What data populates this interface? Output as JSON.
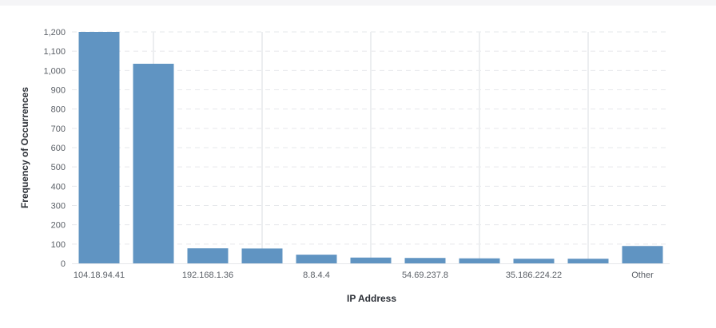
{
  "chart_data": {
    "type": "bar",
    "xlabel": "IP Address",
    "ylabel": "Frequency of Occurrences",
    "ylim": [
      0,
      1200
    ],
    "yticks": [
      0,
      100,
      200,
      300,
      400,
      500,
      600,
      700,
      800,
      900,
      1000,
      1100,
      1200
    ],
    "ytick_labels": [
      "0",
      "100",
      "200",
      "300",
      "400",
      "500",
      "600",
      "700",
      "800",
      "900",
      "1,000",
      "1,100",
      "1,200"
    ],
    "categories": [
      "104.18.94.41",
      "",
      "192.168.1.36",
      "",
      "8.8.4.4",
      "",
      "54.69.237.8",
      "",
      "35.186.224.22",
      "",
      "Other"
    ],
    "values": [
      1205,
      1035,
      78,
      77,
      45,
      30,
      28,
      26,
      24,
      24,
      90
    ],
    "bar_color": "#6094c2",
    "grid": true,
    "legend": "none"
  }
}
